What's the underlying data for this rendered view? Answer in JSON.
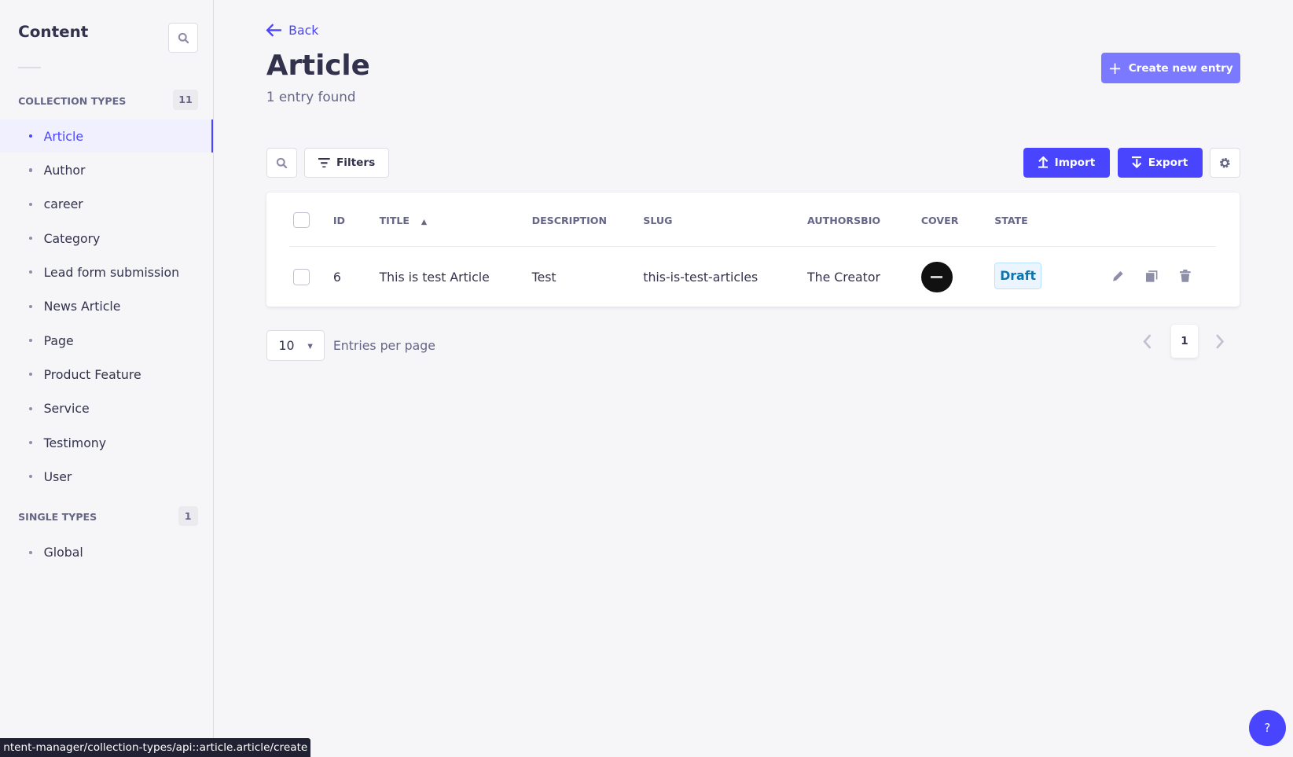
{
  "sidebar": {
    "title": "Content",
    "collection_label": "COLLECTION TYPES",
    "collection_count": "11",
    "collection_items": [
      "Article",
      "Author",
      "career",
      "Category",
      "Lead form submission",
      "News Article",
      "Page",
      "Product Feature",
      "Service",
      "Testimony",
      "User"
    ],
    "single_label": "SINGLE TYPES",
    "single_count": "1",
    "single_items": [
      "Global"
    ]
  },
  "header": {
    "back": "Back",
    "title": "Article",
    "subtitle": "1 entry found",
    "create": "Create new entry"
  },
  "toolbar": {
    "filters": "Filters",
    "import": "Import",
    "export": "Export"
  },
  "table": {
    "columns": [
      "ID",
      "TITLE",
      "DESCRIPTION",
      "SLUG",
      "AUTHORSBIO",
      "COVER",
      "STATE"
    ],
    "rows": [
      {
        "id": "6",
        "title": "This is test Article",
        "description": "Test",
        "slug": "this-is-test-articles",
        "authorsbio": "The Creator",
        "state": "Draft"
      }
    ]
  },
  "pagination": {
    "per_page": "10",
    "per_page_label": "Entries per page",
    "current": "1"
  },
  "status_url": "ntent-manager/collection-types/api::article.article/create",
  "help": "?",
  "colors": {
    "accent": "#4945ff",
    "draft_text": "#0c75af",
    "draft_bg": "#eaf5ff"
  }
}
